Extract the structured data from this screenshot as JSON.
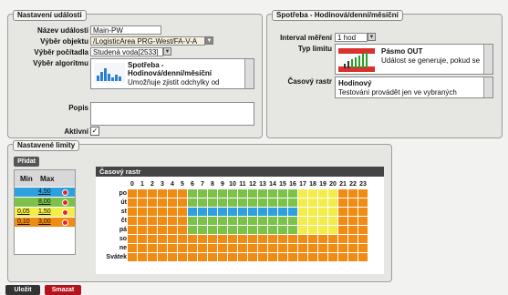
{
  "settings": {
    "title": "Nastavení události",
    "name_label": "Název události",
    "name_value": "Main-PW",
    "object_label": "Výběr objektu",
    "object_value": "/LogisticArea PRG-West/FA-V-A",
    "counter_label": "Výběr počítadla",
    "counter_value": "Studená voda[2533]",
    "algorithm_label": "Výběr algoritmu",
    "algorithm_title": "Spotřeba - Hodinová/denní/měsíční",
    "algorithm_desc": "Umožňuje zjistit odchylky od",
    "desc_label": "Popis",
    "desc_value": "",
    "active_label": "Aktivní",
    "active_checked": true
  },
  "consumption": {
    "title": "Spotřeba - Hodinová/denní/měsíční",
    "interval_label": "Interval měření",
    "interval_value": "1 hod",
    "limit_type_label": "Typ limitu",
    "limit_type_title": "Pásmo OUT",
    "limit_type_desc": "Událost se generuje, pokud se",
    "raster_label": "Časový rastr",
    "raster_title": "Hodinový",
    "raster_desc": "Testování provádět jen ve vybraných"
  },
  "limits": {
    "title": "Nastavené limity",
    "add_label": "Přidat",
    "col_min": "Min",
    "col_max": "Max",
    "rows": [
      {
        "min": "",
        "max": "4,50",
        "color": "#2ea0e0"
      },
      {
        "min": "",
        "max": "8,00",
        "color": "#7cc24a"
      },
      {
        "min": "0,05",
        "max": "1,50",
        "color": "#f2ec4c"
      },
      {
        "min": "0,10",
        "max": "3,00",
        "color": "#f08c14"
      }
    ],
    "raster_title": "Časový rastr",
    "hours": [
      "0",
      "1",
      "2",
      "3",
      "4",
      "5",
      "6",
      "7",
      "8",
      "9",
      "10",
      "11",
      "12",
      "13",
      "14",
      "15",
      "16",
      "17",
      "18",
      "19",
      "20",
      "21",
      "22",
      "23"
    ],
    "days": [
      "po",
      "út",
      "st",
      "čt",
      "pá",
      "so",
      "ne",
      "Svátek"
    ],
    "colors": {
      "O": "c-or",
      "G": "c-gr",
      "B": "c-bl",
      "Y": "c-ye"
    },
    "grid": [
      "OOOOOOGGGGGGGGGGGYYYYOOO",
      "OOOOOOGGGGGGGGGGGYYYYOOO",
      "OOOOOOBBBBBBBBBBBYYYYOOO",
      "OOOOOOGGGGGGGGGGGYYYYOOO",
      "OOOOOOGGGGGGGGGGGYYYYOOO",
      "OOOOOOOOOOOOOOOOOOOOOOOO",
      "OOOOOOOOOOOOOOOOOOOOOOOO",
      "OOOOOOOOOOOOOOOOOOOOOOOO"
    ]
  },
  "footer": {
    "save_label": "Uložit",
    "delete_label": "Smazat"
  }
}
